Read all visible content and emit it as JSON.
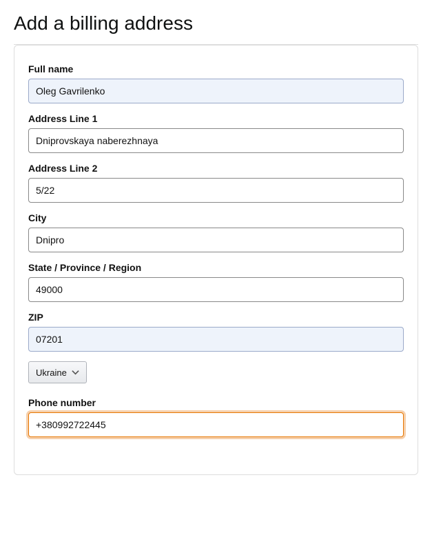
{
  "title": "Add a billing address",
  "fields": {
    "full_name": {
      "label": "Full name",
      "value": "Oleg Gavrilenko"
    },
    "address1": {
      "label": "Address Line 1",
      "value": "Dniprovskaya naberezhnaya"
    },
    "address2": {
      "label": "Address Line 2",
      "value": "5/22"
    },
    "city": {
      "label": "City",
      "value": "Dnipro"
    },
    "state": {
      "label": "State / Province / Region",
      "value": "49000"
    },
    "zip": {
      "label": "ZIP",
      "value": "07201"
    },
    "country": {
      "selected": "Ukraine"
    },
    "phone": {
      "label": "Phone number",
      "value": "+380992722445"
    }
  }
}
